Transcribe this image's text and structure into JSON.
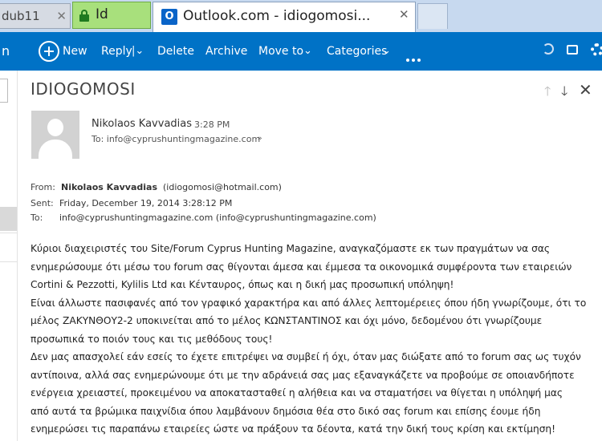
{
  "browser": {
    "tab1_label": "dub11",
    "tab1_close": "✕",
    "tab2_label": "Id",
    "tab3_title": "Outlook.com - idiogomosi...",
    "tab3_icon_letter": "O",
    "tab3_close": "✕"
  },
  "toolbar": {
    "left_fragment": "n",
    "new_label": "New",
    "reply_label": "Reply",
    "reply_arrow": "|⌄",
    "delete_label": "Delete",
    "archive_label": "Archive",
    "moveto_label": "Move to",
    "moveto_arrow": "⌄",
    "categories_label": "Categories",
    "categories_arrow": "⌄"
  },
  "message": {
    "subject": "IDIOGOMOSI",
    "sender_name": "Nikolaos Kavvadias",
    "time": "3:28 PM",
    "to_line": "To: info@cyprushuntingmagazine.com",
    "expand_glyph": "»",
    "header": {
      "from_label": "From:",
      "from_name": "Nikolaos Kavvadias",
      "from_email": "(idiogomosi@hotmail.com)",
      "sent_label": "Sent:",
      "sent_value": "Friday, December 19, 2014 3:28:12 PM",
      "to_label": "To:",
      "to_value": "info@cyprushuntingmagazine.com (info@cyprushuntingmagazine.com)"
    },
    "body_lines": [
      "Κύριοι διαχειριστές του Site/Forum Cyprus Hunting Magazine, αναγκαζόμαστε εκ των πραγμάτων να σας",
      "ενημερώσουμε ότι μέσω του forum σας θίγονται άμεσα και έμμεσα τα οικονομικά συμφέροντα των εταιρειών",
      "Cortini & Pezzotti, Kylilis Ltd και Κένταυρος, όπως και η δική μας προσωπική υπόληψη!",
      "Είναι άλλωστε πασιφανές από τον γραφικό χαρακτήρα και από άλλες λεπτομέρειες όπου ήδη γνωρίζουμε, ότι το",
      "μέλος ΖΑΚΥΝΘΟΥ2-2 υποκινείται από το μέλος ΚΩΝΣΤΑΝΤΙΝΟΣ και όχι μόνο, δεδομένου ότι γνωρίζουμε",
      "προσωπικά το ποιόν τους και τις μεθόδους τους!",
      "Δεν μας απασχολεί εάν εσείς το έχετε επιτρέψει να συμβεί ή όχι, όταν μας διώξατε από το forum σας ως τυχόν",
      "αντίποινα, αλλά σας ενημερώνουμε ότι με την αδράνειά σας μας εξαναγκάζετε να προβούμε σε οποιανδήποτε",
      "ενέργεια χρειαστεί, προκειμένου να αποκατασταθεί η αλήθεια και να σταματήσει να θίγεται η υπόληψή μας",
      "από αυτά τα βρώμικα παιχνίδια όπου λαμβάνουν δημόσια θέα στο δικό σας forum και επίσης έουμε ήδη",
      "ενημερώσει τις παραπάνω εταιρείες ώστε να πράξουν τα δέοντα, κατά την δική τους κρίση και εκτίμηση!"
    ]
  },
  "icons": {
    "nav_up": "🡑",
    "nav_down": "🡓",
    "close": "✕"
  },
  "colors": {
    "accent": "#0072c6",
    "tab_highlight": "#a8e07c",
    "tabstrip": "#c7d9ef"
  }
}
